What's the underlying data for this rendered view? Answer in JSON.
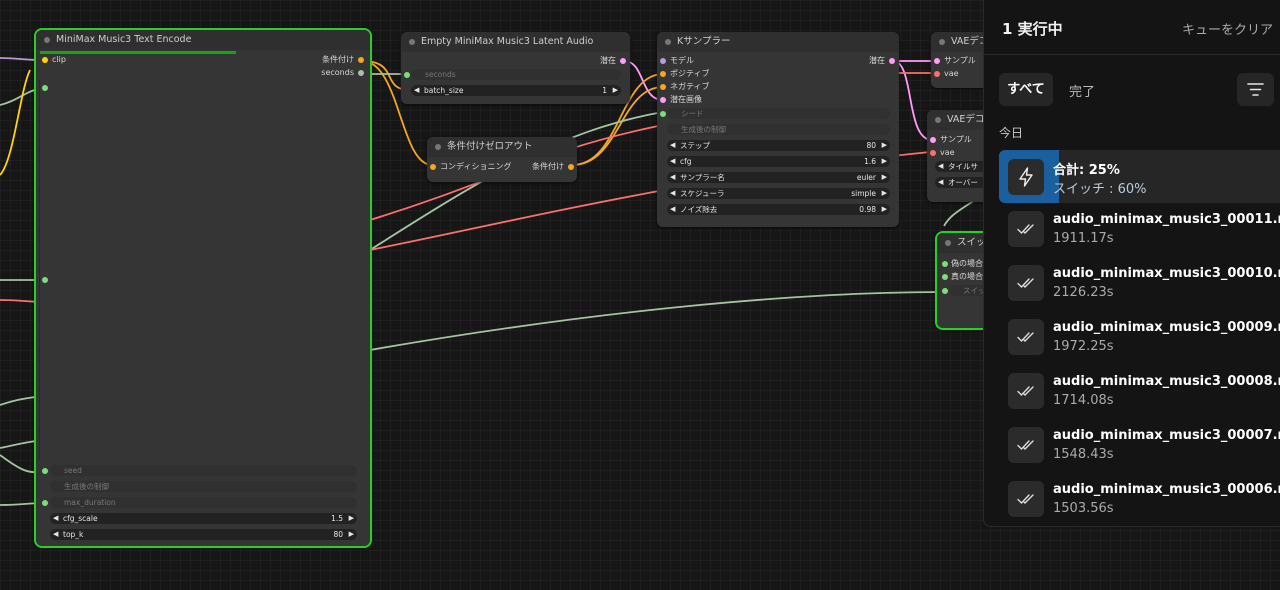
{
  "nodes": {
    "text_encode": {
      "title": "MiniMax Music3 Text Encode",
      "input_clip": "clip",
      "out_conditioning": "条件付け",
      "out_seconds": "seconds",
      "w_seed": "seed",
      "w_control": "生成後の制御",
      "w_max_duration": "max_duration",
      "w_cfg_scale": "cfg_scale",
      "w_cfg_scale_val": "1.5",
      "w_top_k": "top_k",
      "w_top_k_val": "80"
    },
    "latent": {
      "title": "Empty MiniMax Music3 Latent Audio",
      "out_latent": "潜在",
      "in_seconds": "seconds",
      "w_batch": "batch_size",
      "w_batch_val": "1"
    },
    "zero_out": {
      "title": "条件付けゼロアウト",
      "in_cond": "コンディショニング",
      "out_cond": "条件付け"
    },
    "ksampler": {
      "title": "Kサンプラー",
      "in_model": "モデル",
      "in_positive": "ポジティブ",
      "in_negative": "ネガティブ",
      "in_latent": "潜在画像",
      "out_latent": "潜在",
      "w_seed": "シード",
      "w_control": "生成後の制御",
      "w_steps": "ステップ",
      "w_steps_val": "80",
      "w_cfg": "cfg",
      "w_cfg_val": "1.6",
      "w_sampler": "サンプラー名",
      "w_sampler_val": "euler",
      "w_scheduler": "スケジューラ",
      "w_scheduler_val": "simple",
      "w_denoise": "ノイズ除去",
      "w_denoise_val": "0.98"
    },
    "vae1": {
      "title": "VAEデコ",
      "in_samples": "サンプル",
      "in_vae": "vae"
    },
    "vae2": {
      "title": "VAEデコ",
      "in_samples": "サンプル",
      "in_vae": "vae",
      "w_tile": "タイルサ",
      "w_over": "オーバー"
    },
    "switch": {
      "title": "スイッ",
      "in_false": "偽の場合",
      "in_true": "真の場合",
      "w_switch": "スイッ"
    }
  },
  "queue": {
    "title": "1 実行中",
    "clear": "キューをクリア",
    "tab_all": "すべて",
    "tab_done": "完了",
    "section": "今日",
    "running": {
      "title": "合計: 25%",
      "subtitle": "スイッチ : 60%",
      "progress": 0.25
    },
    "items": [
      {
        "name": "audio_minimax_music3_00011.mp3",
        "duration": "1911.17s"
      },
      {
        "name": "audio_minimax_music3_00010.mp3",
        "duration": "2126.23s"
      },
      {
        "name": "audio_minimax_music3_00009.mp3",
        "duration": "1972.25s"
      },
      {
        "name": "audio_minimax_music3_00008.mp3",
        "duration": "1714.08s"
      },
      {
        "name": "audio_minimax_music3_00007.mp3",
        "duration": "1548.43s"
      },
      {
        "name": "audio_minimax_music3_00006.mp3",
        "duration": "1503.56s"
      }
    ]
  },
  "colors": {
    "selected": "#26d026",
    "wire_conditioning": "#f5a623",
    "wire_latent": "#ff9cf9",
    "wire_int": "#a4c4a0",
    "wire_vae": "#ff6e6e",
    "wire_clip": "#ffd500",
    "accent": "#1a5f9e"
  }
}
